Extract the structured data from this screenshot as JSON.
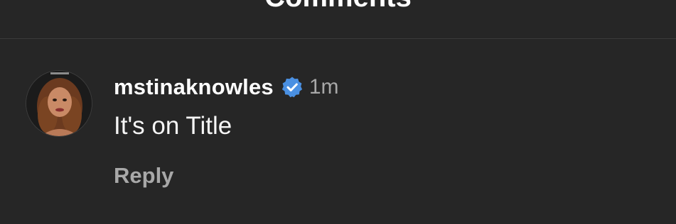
{
  "header": {
    "title": "Comments"
  },
  "comment": {
    "username": "mstinaknowles",
    "verified": true,
    "time": "1m",
    "text": "It's on Title",
    "reply_label": "Reply",
    "avatar_icon": "profile-photo",
    "verified_icon": "verified-badge-icon"
  },
  "colors": {
    "background": "#262626",
    "text_primary": "#ffffff",
    "text_secondary": "#a8a8a8",
    "verified_badge": "#4a90e2",
    "divider": "#3a3a3a"
  }
}
